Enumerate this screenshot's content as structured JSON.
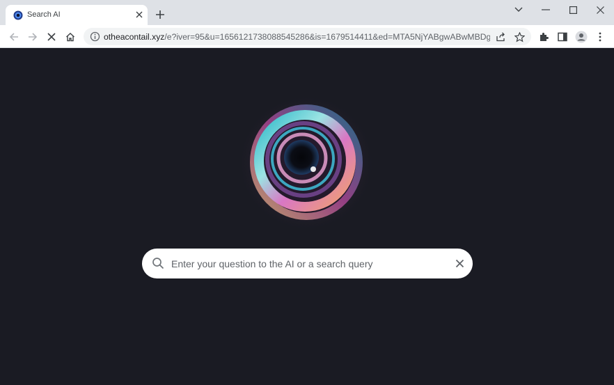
{
  "browser": {
    "tab": {
      "title": "Search AI",
      "favicon": "swirl-favicon-icon"
    },
    "address": {
      "host": "otheacontail.xyz",
      "path": "/e?iver=95&u=1656121738088545286&is=1679514411&ed=MTA5NjYABgwABwMBDg..."
    },
    "colors": {
      "tabstrip": "#dee1e6",
      "toolbar": "#ffffff",
      "omnibox": "#f1f3f4"
    }
  },
  "page": {
    "background": "#1a1b23",
    "search": {
      "placeholder": "Enter your question to the AI or a search query",
      "value": ""
    }
  }
}
